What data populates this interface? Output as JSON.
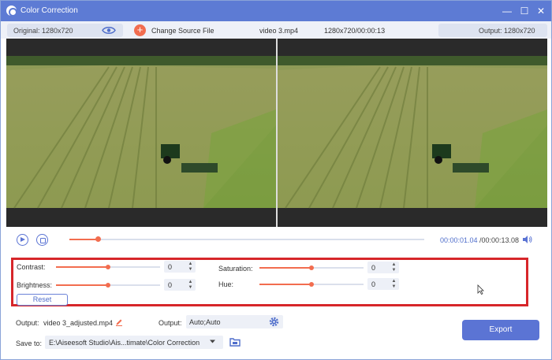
{
  "window": {
    "title": "Color Correction",
    "controls": {
      "minimize": "—",
      "maximize": "☐",
      "close": "✕"
    }
  },
  "infobar": {
    "original": "Original: 1280x720",
    "change_source": "Change Source File",
    "file_name": "video 3.mp4",
    "file_meta": "1280x720/00:00:13",
    "output": "Output: 1280x720"
  },
  "playback": {
    "current_time": "00:00:01.04",
    "total_time": "/00:00:13.08",
    "progress": 0.08
  },
  "adjust": {
    "contrast": {
      "label": "Contrast:",
      "value": "0",
      "level": 0.5
    },
    "brightness": {
      "label": "Brightness:",
      "value": "0",
      "level": 0.5
    },
    "saturation": {
      "label": "Saturation:",
      "value": "0",
      "level": 0.5
    },
    "hue": {
      "label": "Hue:",
      "value": "0",
      "level": 0.5
    },
    "reset_label": "Reset"
  },
  "output_row": {
    "output_label": "Output:",
    "output_file": "video 3_adjusted.mp4",
    "format_label": "Output:",
    "format_value": "Auto;Auto"
  },
  "save_row": {
    "save_label": "Save to:",
    "save_path": "E:\\Aiseesoft Studio\\Ais...timate\\Color Correction"
  },
  "export_label": "Export",
  "colors": {
    "accent": "#5b74d4",
    "titlebar": "#5d7bd4",
    "slider": "#f26d4f",
    "highlight_border": "#d7262a"
  }
}
